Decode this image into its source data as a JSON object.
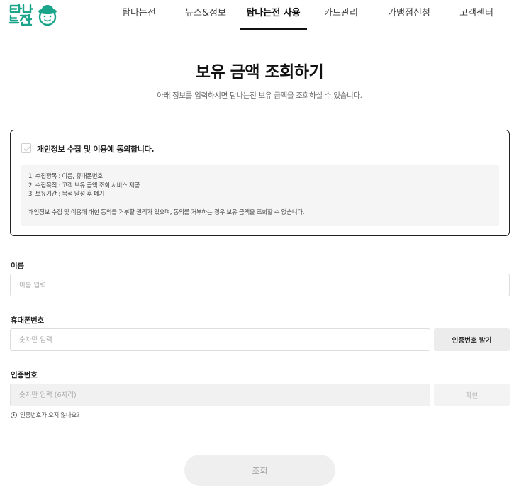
{
  "header": {
    "logo_text": "탐나는전",
    "brand_color": "#1aa58a",
    "nav": [
      {
        "label": "탐나는전",
        "active": false
      },
      {
        "label": "뉴스&정보",
        "active": false
      },
      {
        "label": "탐나는전 사용",
        "active": true
      },
      {
        "label": "카드관리",
        "active": false
      },
      {
        "label": "가맹점신청",
        "active": false
      },
      {
        "label": "고객센터",
        "active": false
      }
    ]
  },
  "page": {
    "title": "보유 금액 조회하기",
    "subtitle": "아래 정보를 입력하시면 탐나는전 보유 금액을 조회하실 수 있습니다."
  },
  "consent": {
    "label": "개인정보 수집 및 이용에 동의합니다.",
    "checked": false,
    "icon": "check-icon",
    "lines": [
      "1. 수집항목 : 이름, 휴대폰번호",
      "2. 수집목적 : 고객 보유 금액 조회 서비스 제공",
      "3. 보유기간 : 목적 달성 후 폐기"
    ],
    "note": "개인정보 수집 및 이용에 대한 동의를 거부할 권리가 있으며, 동의를 거부하는 경우 보유 금액을 조회할 수 없습니다."
  },
  "form": {
    "name": {
      "label": "이름",
      "placeholder": "이름 입력",
      "value": ""
    },
    "phone": {
      "label": "휴대폰번호",
      "placeholder": "숫자만 입력",
      "value": "",
      "button_label": "인증번호 받기"
    },
    "code": {
      "label": "인증번호",
      "placeholder": "숫자만 입력 (6자리)",
      "value": "",
      "button_label": "확인"
    },
    "help_icon": "info-icon",
    "help_icon_glyph": "i",
    "help_text": "인증번호가 오지 않나요?"
  },
  "submit": {
    "label": "조회"
  }
}
